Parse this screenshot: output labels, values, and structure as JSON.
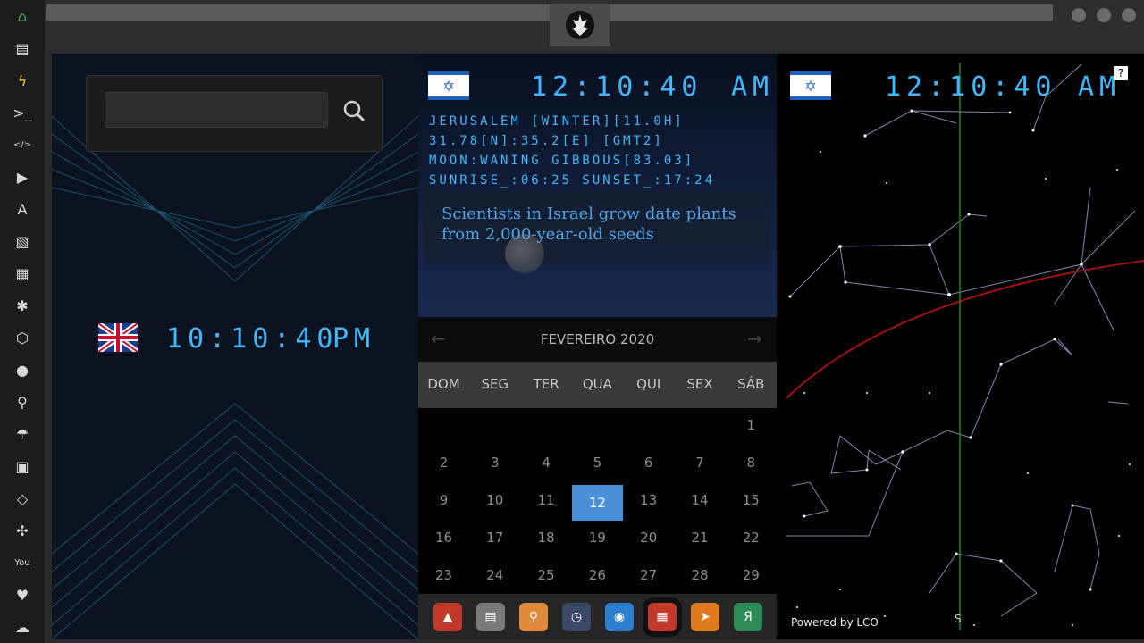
{
  "sidebar": {
    "items": [
      {
        "icon": "home-icon",
        "glyph": "⌂"
      },
      {
        "icon": "document-icon",
        "glyph": "▤"
      },
      {
        "icon": "lightning-icon",
        "glyph": "ϟ"
      },
      {
        "icon": "terminal-icon",
        "glyph": ">_"
      },
      {
        "icon": "code-icon",
        "glyph": "</>"
      },
      {
        "icon": "play-icon",
        "glyph": "▶"
      },
      {
        "icon": "translate-icon",
        "glyph": "A"
      },
      {
        "icon": "image-icon",
        "glyph": "▧"
      },
      {
        "icon": "news-icon",
        "glyph": "▦"
      },
      {
        "icon": "settings-icon",
        "glyph": "✱"
      },
      {
        "icon": "hexagon-icon",
        "glyph": "⬡"
      },
      {
        "icon": "globe-icon",
        "glyph": "●"
      },
      {
        "icon": "search-icon",
        "glyph": "⚲"
      },
      {
        "icon": "umbrella-icon",
        "glyph": "☂"
      },
      {
        "icon": "contacts-icon",
        "glyph": "▣"
      },
      {
        "icon": "link-icon",
        "glyph": "◇"
      },
      {
        "icon": "expand-icon",
        "glyph": "✣"
      },
      {
        "icon": "youtube-icon",
        "glyph": "You"
      },
      {
        "icon": "heart-icon",
        "glyph": "♥"
      },
      {
        "icon": "cloud-icon",
        "glyph": "☁"
      }
    ]
  },
  "accent": "#3fb8ff",
  "left_panel": {
    "search": {
      "placeholder": "",
      "value": ""
    },
    "uk_clock": {
      "time": "10:10:40",
      "ampm": "PM"
    }
  },
  "mid_panel": {
    "clock": {
      "time": "12:10:40",
      "ampm": "AM"
    },
    "info_lines": [
      "JERUSALEM [WINTER][11.0H]",
      "31.78[N]:35.2[E] [GMT2]",
      "MOON:WANING GIBBOUS[83.03]",
      "SUNRISE_:06:25 SUNSET_:17:24"
    ],
    "news": "Scientists in Israel grow date plants from 2,000-year-old seeds",
    "calendar": {
      "title": "FEVEREIRO 2020",
      "prev_arrow": "←",
      "next_arrow": "→",
      "days": [
        "DOM",
        "SEG",
        "TER",
        "QUA",
        "QUI",
        "SEX",
        "SÁB"
      ],
      "weeks": [
        [
          "",
          "",
          "",
          "",
          "",
          "",
          "1"
        ],
        [
          "2",
          "3",
          "4",
          "5",
          "6",
          "7",
          "8"
        ],
        [
          "9",
          "10",
          "11",
          "12",
          "13",
          "14",
          "15"
        ],
        [
          "16",
          "17",
          "18",
          "19",
          "20",
          "21",
          "22"
        ],
        [
          "23",
          "24",
          "25",
          "26",
          "27",
          "28",
          "29"
        ]
      ],
      "selected": "12"
    },
    "dock": [
      {
        "icon": "triangle-app-icon",
        "glyph": "▲",
        "color": "#c0392b"
      },
      {
        "icon": "news-app-icon",
        "glyph": "▤",
        "color": "#7a7a7a"
      },
      {
        "icon": "search-app-icon",
        "glyph": "⚲",
        "color": "#e08a3c"
      },
      {
        "icon": "clock-app-icon",
        "glyph": "◷",
        "color": "#3a4a66"
      },
      {
        "icon": "globe-app-icon",
        "glyph": "◉",
        "color": "#2f7fd0"
      },
      {
        "icon": "calendar-app-icon",
        "glyph": "▦",
        "color": "#c0392b"
      },
      {
        "icon": "arrow-app-icon",
        "glyph": "➤",
        "color": "#e07a1f"
      },
      {
        "icon": "yandex-app-icon",
        "glyph": "Я",
        "color": "#2e8b57"
      }
    ]
  },
  "right_panel": {
    "clock": {
      "time": "12:10:40",
      "ampm": "AM"
    },
    "help": "?",
    "compass": "S",
    "powered_by": "Powered by LCO"
  }
}
